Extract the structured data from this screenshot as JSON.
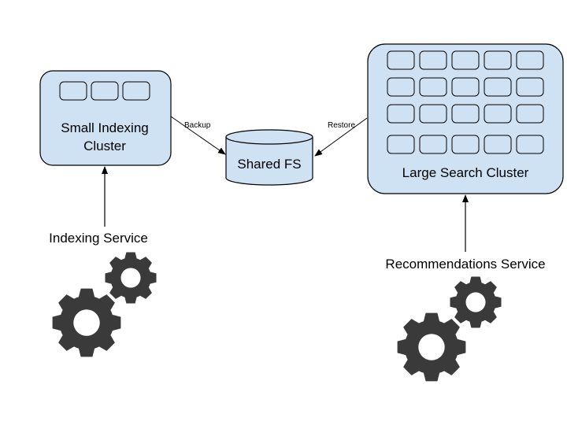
{
  "colors": {
    "node_fill": "#cfe2f3",
    "stroke": "#000000",
    "gear": "#3a3a3a",
    "background": "#ffffff"
  },
  "small_cluster": {
    "label_line1": "Small Indexing",
    "label_line2": "Cluster",
    "node_count": 3
  },
  "large_cluster": {
    "label": "Large Search Cluster",
    "rows": 4,
    "cols": 5
  },
  "shared_fs": {
    "label": "Shared FS"
  },
  "edges": {
    "backup_label": "Backup",
    "restore_label": "Restore"
  },
  "indexing_service": {
    "label": "Indexing Service",
    "icon": "gears-icon"
  },
  "recommendations_service": {
    "label": "Recommendations Service",
    "icon": "gears-icon"
  }
}
